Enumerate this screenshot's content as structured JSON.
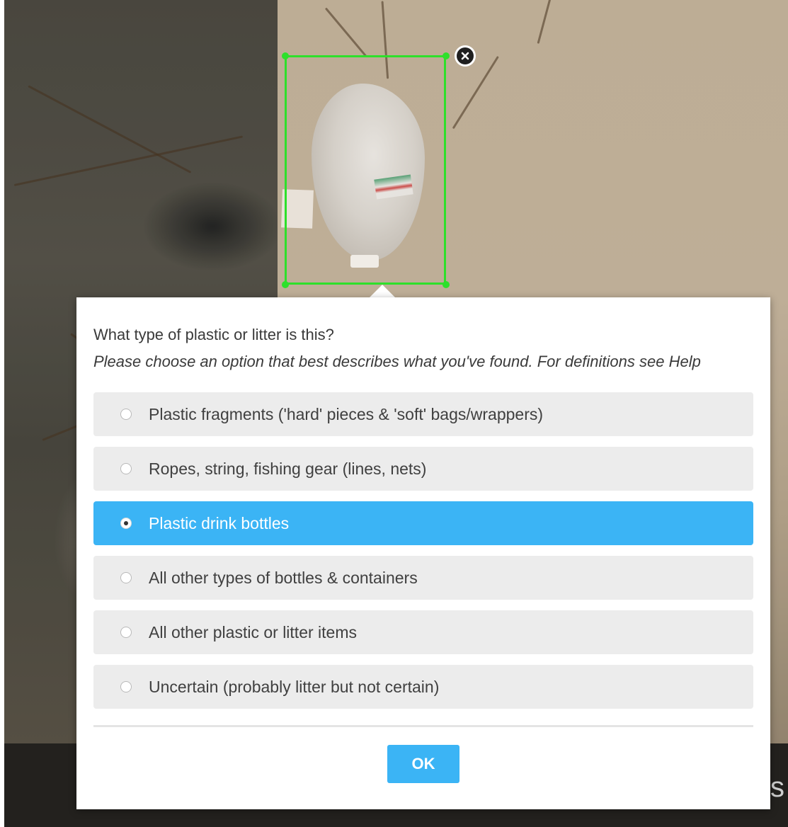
{
  "dialog": {
    "question": "What type of plastic or litter is this?",
    "hint": "Please choose an option that best describes what you've found. For definitions see Help",
    "options": [
      {
        "label": "Plastic fragments ('hard' pieces & 'soft' bags/wrappers)",
        "selected": false
      },
      {
        "label": "Ropes, string, fishing gear (lines, nets)",
        "selected": false
      },
      {
        "label": "Plastic drink bottles",
        "selected": true
      },
      {
        "label": "All other types of bottles & containers",
        "selected": false
      },
      {
        "label": "All other plastic or litter items",
        "selected": false
      },
      {
        "label": "Uncertain (probably litter but not certain)",
        "selected": false
      }
    ],
    "ok_label": "OK"
  },
  "selection": {
    "close_icon": "close-circle-icon",
    "box_color": "#2de02b"
  },
  "background": {
    "corner_text": "s"
  },
  "colors": {
    "accent": "#3bb4f5",
    "option_bg": "#ececec",
    "text": "#3a3a3a"
  }
}
